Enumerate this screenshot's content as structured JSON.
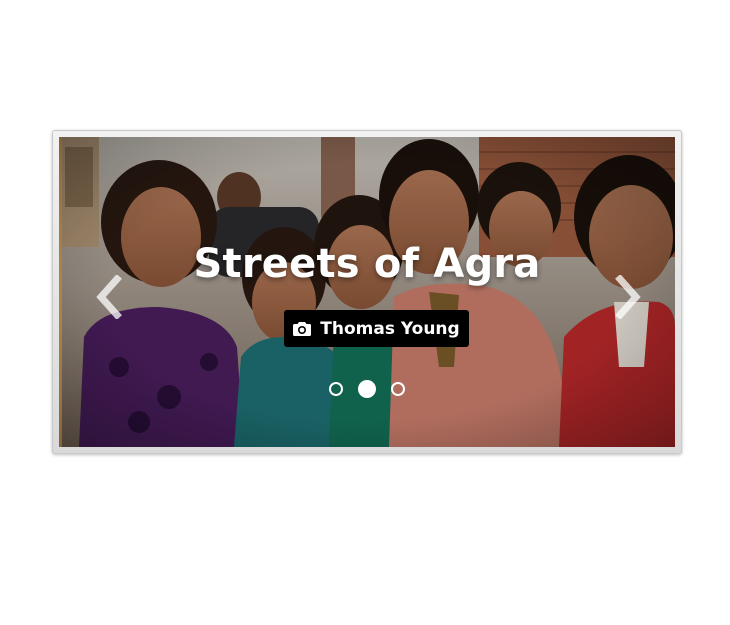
{
  "slider": {
    "title": "Streets of Agra",
    "credit": "Thomas Young",
    "credit_icon": "camera-icon",
    "prev_icon": "chevron-left-icon",
    "next_icon": "chevron-right-icon",
    "slide_count": 3,
    "active_index": 1,
    "image_description_alt": "Group of smiling children"
  },
  "colors": {
    "caption_text": "#ffffff",
    "credit_background": "#000000",
    "frame": "#e0e0e0"
  }
}
